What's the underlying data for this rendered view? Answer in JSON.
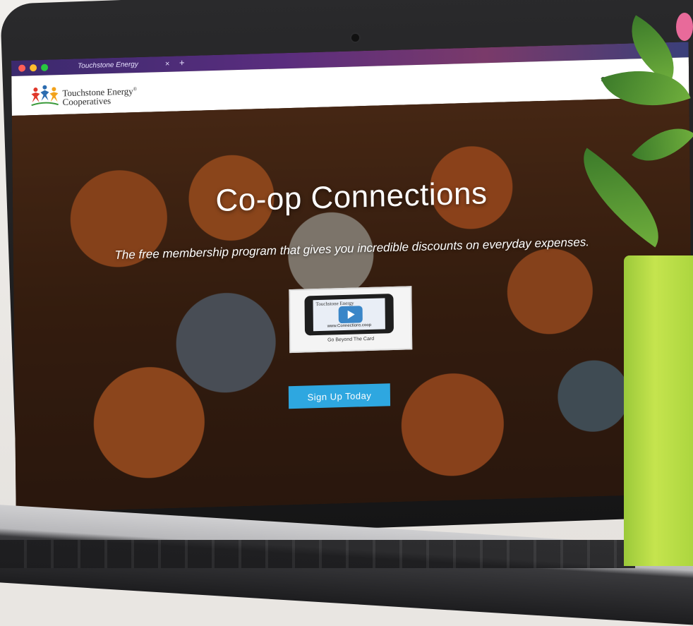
{
  "browser": {
    "tab_title": "Touchstone Energy",
    "tab_close": "×",
    "tab_new": "+"
  },
  "site": {
    "logo_line1": "Touchstone Energy",
    "logo_reg": "®",
    "logo_line2": "Cooperatives",
    "header_right": "s"
  },
  "hero": {
    "title": "Co-op Connections",
    "subtitle": "The free membership program that gives you incredible discounts on everyday expenses.",
    "video": {
      "logo_text": "Touchstone Energy",
      "url": "www.Connections.coop",
      "caption": "Go Beyond The Card"
    },
    "cta_label": "Sign Up Today"
  },
  "colors": {
    "cta": "#2ea7e0",
    "header_bg": "#ffffff",
    "pot": "#b8dc45"
  }
}
